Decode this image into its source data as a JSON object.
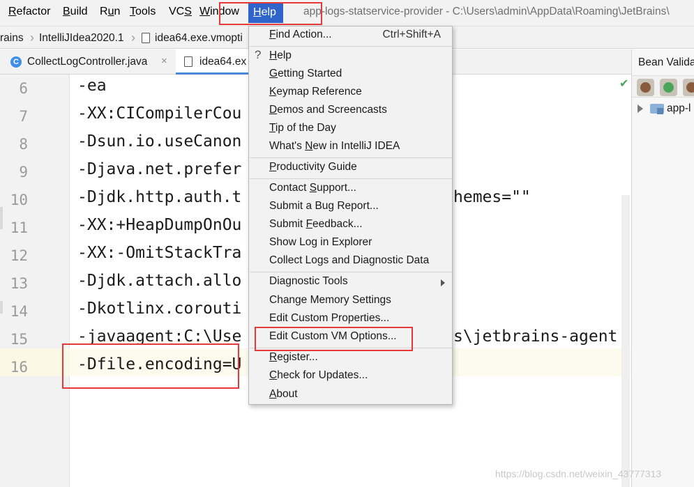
{
  "menubar": {
    "items": [
      {
        "pre": "",
        "ul": "R",
        "post": "efactor"
      },
      {
        "pre": "",
        "ul": "B",
        "post": "uild"
      },
      {
        "pre": "R",
        "ul": "u",
        "post": "n"
      },
      {
        "pre": "",
        "ul": "T",
        "post": "ools"
      },
      {
        "pre": "VC",
        "ul": "S",
        "post": ""
      },
      {
        "pre": "",
        "ul": "W",
        "post": "indow"
      }
    ],
    "help": {
      "pre": "",
      "ul": "H",
      "post": "elp"
    },
    "title": "app-logs-statservice-provider - C:\\Users\\admin\\AppData\\Roaming\\JetBrains\\"
  },
  "breadcrumb": {
    "items": [
      "rains",
      "IntelliJIdea2020.1",
      "idea64.exe.vmopti"
    ]
  },
  "tabs": [
    {
      "label": "CollectLogController.java",
      "icon": "C",
      "close": "×"
    },
    {
      "label": "idea64.ex",
      "close": ""
    }
  ],
  "right_panel": {
    "title": "Bean Valida",
    "tree_item": "app-l"
  },
  "editor": {
    "lines": [
      {
        "num": "6",
        "code": "-ea"
      },
      {
        "num": "7",
        "code": "-XX:CICompilerCou"
      },
      {
        "num": "8",
        "code": "-Dsun.io.useCanon"
      },
      {
        "num": "9",
        "code": "-Djava.net.prefer"
      },
      {
        "num": "10",
        "code": "-Djdk.http.auth.t",
        "tail": "hemes=\"\""
      },
      {
        "num": "11",
        "code": "-XX:+HeapDumpOnOu"
      },
      {
        "num": "12",
        "code": "-XX:-OmitStackTra"
      },
      {
        "num": "13",
        "code": "-Djdk.attach.allo"
      },
      {
        "num": "14",
        "code": "-Dkotlinx.corouti"
      },
      {
        "num": "15",
        "code": "-javaagent:C:\\Use",
        "tail": "s\\jetbrains-agent"
      },
      {
        "num": "16",
        "code": "-Dfile.encoding=U"
      }
    ]
  },
  "help_menu": {
    "items": [
      {
        "pre": "",
        "ul": "F",
        "post": "ind Action...",
        "shortcut": "Ctrl+Shift+A"
      },
      {
        "pre": "",
        "ul": "H",
        "post": "elp",
        "icon": "?"
      },
      {
        "pre": "",
        "ul": "G",
        "post": "etting Started"
      },
      {
        "pre": "",
        "ul": "K",
        "post": "eymap Reference"
      },
      {
        "pre": "",
        "ul": "D",
        "post": "emos and Screencasts"
      },
      {
        "pre": "",
        "ul": "T",
        "post": "ip of the Day"
      },
      {
        "pre": "What's ",
        "ul": "N",
        "post": "ew in IntelliJ IDEA"
      },
      {
        "pre": "",
        "ul": "P",
        "post": "roductivity Guide"
      },
      {
        "pre": "Contact ",
        "ul": "S",
        "post": "upport..."
      },
      {
        "pre": "Submit a Bug Report...",
        "ul": "",
        "post": ""
      },
      {
        "pre": "Submit ",
        "ul": "F",
        "post": "eedback..."
      },
      {
        "pre": "Show Log in Explorer",
        "ul": "",
        "post": ""
      },
      {
        "pre": "Collect Logs and Diagnostic Data",
        "ul": "",
        "post": ""
      },
      {
        "pre": "Diagnostic Tools",
        "ul": "",
        "post": "",
        "submenu": true
      },
      {
        "pre": "Change Memory Settings",
        "ul": "",
        "post": ""
      },
      {
        "pre": "Edit Custom Properties...",
        "ul": "",
        "post": ""
      },
      {
        "pre": "Edit Custom VM Options...",
        "ul": "",
        "post": ""
      },
      {
        "pre": "",
        "ul": "R",
        "post": "egister..."
      },
      {
        "pre": "",
        "ul": "C",
        "post": "heck for Updates..."
      },
      {
        "pre": "",
        "ul": "A",
        "post": "bout"
      }
    ]
  },
  "watermark": "https://blog.csdn.net/weixin_43777313",
  "colors": {
    "help_active": "#2f65ca",
    "highlight_box": "#e8393a",
    "tab_underline": "#4a88d8"
  }
}
